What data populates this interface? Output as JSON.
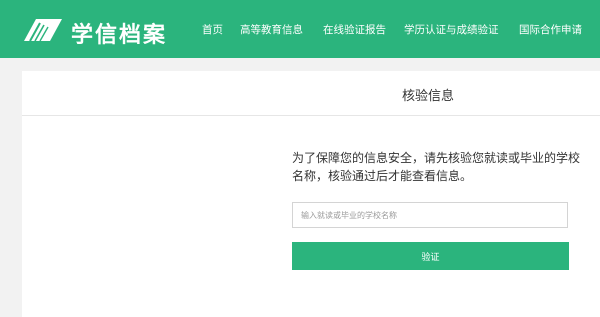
{
  "header": {
    "brand": "学信档案",
    "nav": [
      {
        "label": "首页"
      },
      {
        "label": "高等教育信息"
      },
      {
        "label": "在线验证报告"
      },
      {
        "label": "学历认证与成绩验证"
      },
      {
        "label": "国际合作申请"
      }
    ]
  },
  "card": {
    "title": "核验信息",
    "notice": "为了保障您的信息安全，请先核验您就读或毕业的学校名称，核验通过后才能查看信息。",
    "school_input": {
      "placeholder": "输入就读或毕业的学校名称",
      "value": ""
    },
    "submit_label": "验证"
  },
  "colors": {
    "brand_green": "#2bb47d",
    "page_background": "#f2f2f2",
    "card_background": "#ffffff"
  },
  "icons": {
    "logo": "book-logo-icon"
  }
}
